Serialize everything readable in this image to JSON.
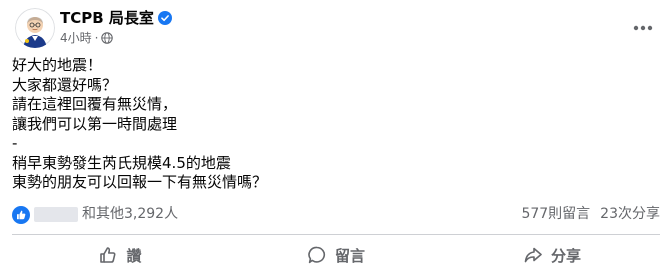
{
  "header": {
    "page_name": "TCPB 局長室",
    "timestamp": "4小時",
    "separator": "·",
    "verified_icon": "verified-badge",
    "privacy_icon": "globe-icon",
    "more_icon": "more-horizontal-icon"
  },
  "post": {
    "lines": [
      "好大的地震！",
      "大家都還好嗎？",
      "請在這裡回覆有無災情，",
      "讓我們可以第一時間處理",
      " -",
      "稍早東勢發生芮氏規模4.5的地震",
      "東勢的朋友可以回報一下有無災情嗎？"
    ]
  },
  "reactions": {
    "summary_text": "和其他3,292人",
    "comments_count": "577則留言",
    "shares_count": "23次分享",
    "like_icon": "like-reaction-icon"
  },
  "actions": {
    "like_label": "讚",
    "comment_label": "留言",
    "share_label": "分享"
  },
  "colors": {
    "text_primary": "#050505",
    "text_secondary": "#65676b",
    "like_blue": "#1877f2",
    "divider": "#ced0d4"
  }
}
